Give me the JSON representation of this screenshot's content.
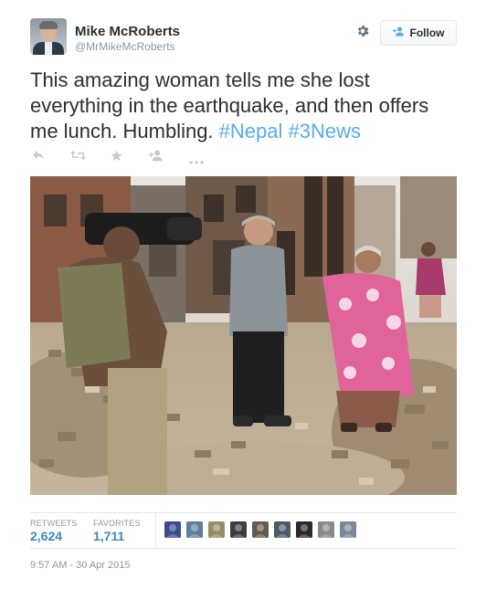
{
  "user": {
    "name": "Mike McRoberts",
    "handle": "@MrMikeMcRoberts"
  },
  "follow_label": "Follow",
  "tweet": {
    "text": "This amazing woman tells me she lost everything in the earthquake, and then offers me lunch. Humbling.",
    "hashtags": [
      "#Nepal",
      "#3News"
    ]
  },
  "icons": {
    "settings": "gear-icon",
    "follow": "add-user-icon",
    "reply": "reply-icon",
    "retweet": "retweet-icon",
    "favorite": "star-icon",
    "follow_action": "add-user-icon",
    "more": "more-icon"
  },
  "stats": {
    "retweets_label": "RETWEETS",
    "retweets_count": "2,624",
    "favorites_label": "FAVORITES",
    "favorites_count": "1,711"
  },
  "favoriter_avatar_colors": [
    "#3a4a8a",
    "#5d7f9a",
    "#9a8a6a",
    "#3d3d3d",
    "#6a5a4a",
    "#4a5a6a",
    "#2a2a2a",
    "#8a8a8a",
    "#7a8a9a"
  ],
  "timestamp": "9:57 AM - 30 Apr 2015"
}
